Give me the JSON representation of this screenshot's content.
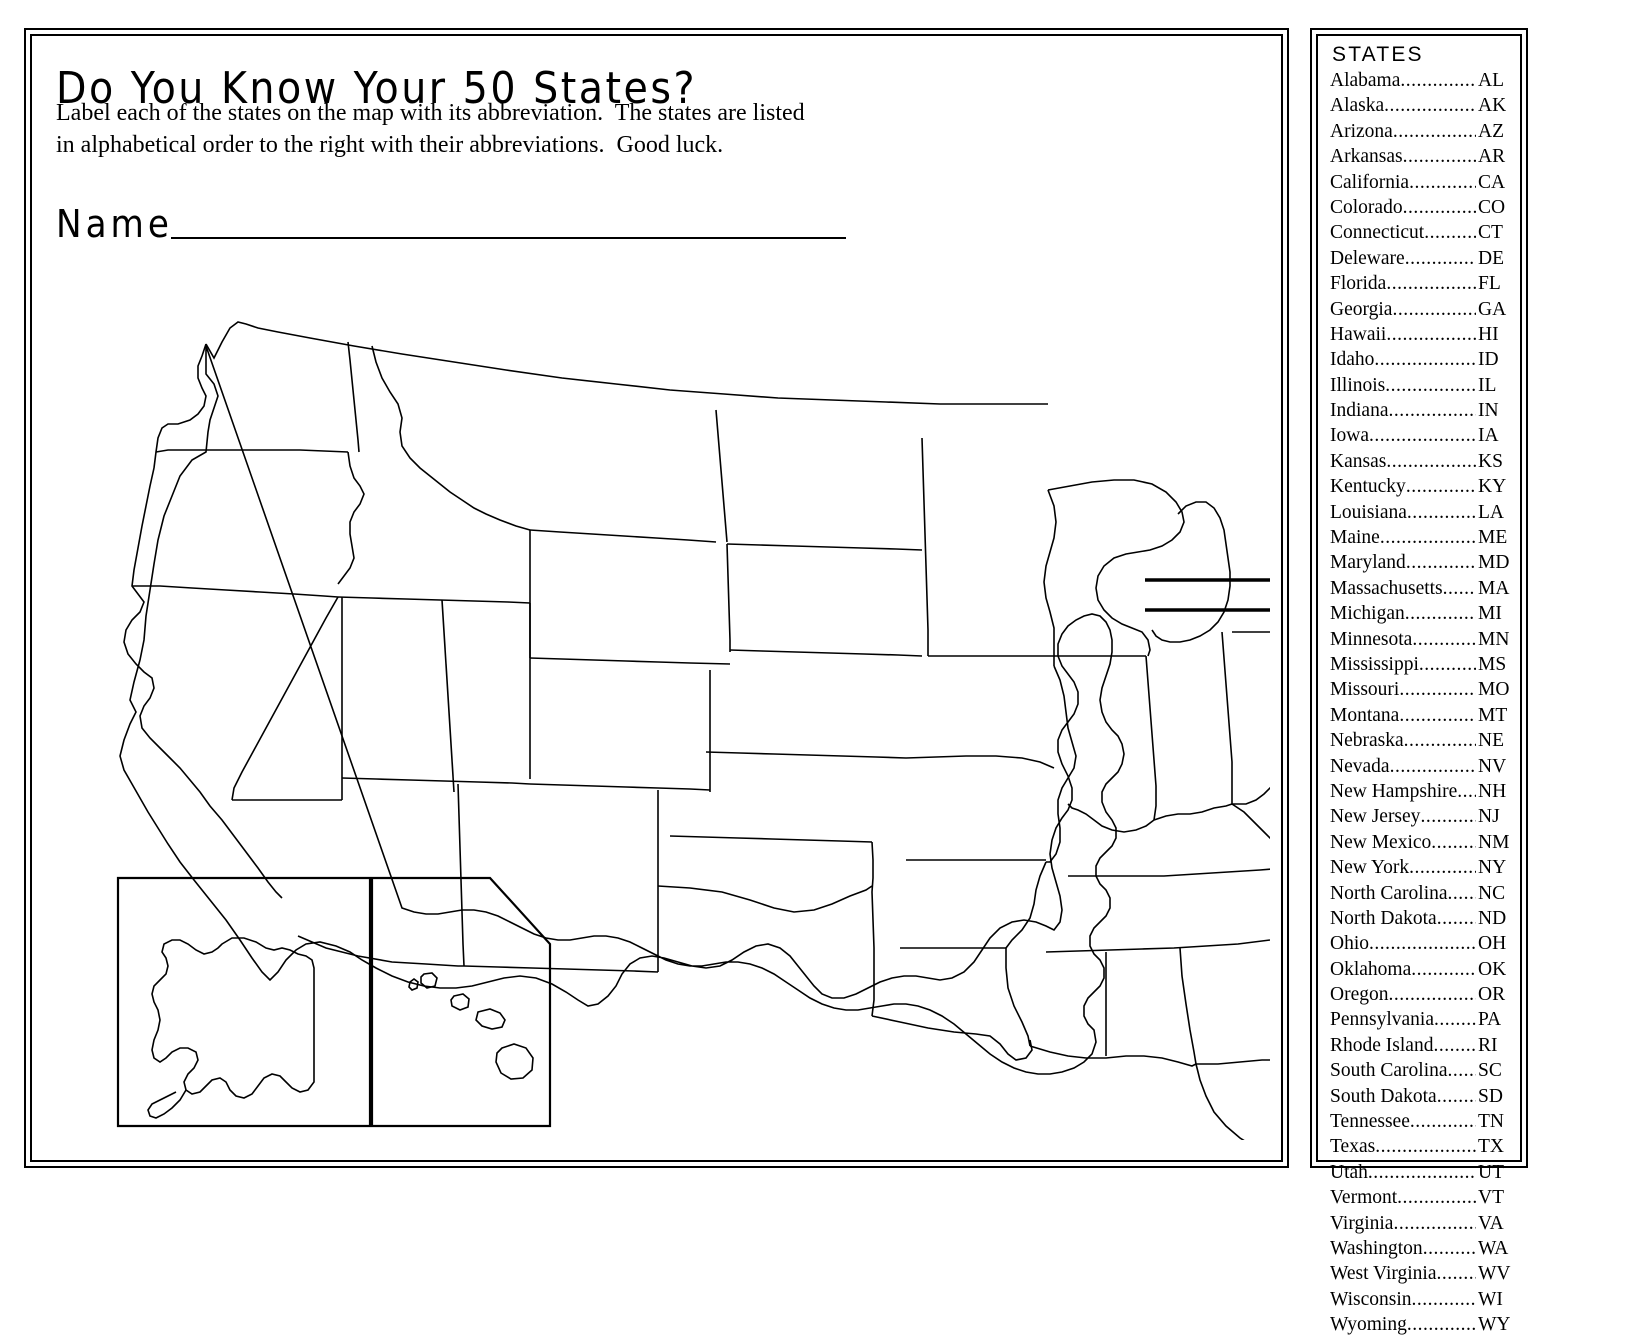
{
  "title": "Do You Know Your 50 States?",
  "instructions": {
    "line1": "Label each of the states on the map with its abbreviation.  The states are listed",
    "line2": "in alphabetical order to the right with their abbreviations.  Good luck."
  },
  "name_label": "Name",
  "states_panel": {
    "header": "STATES",
    "items": [
      {
        "name": "Alabama",
        "abbr": "AL"
      },
      {
        "name": "Alaska",
        "abbr": "AK"
      },
      {
        "name": "Arizona",
        "abbr": "AZ"
      },
      {
        "name": "Arkansas",
        "abbr": "AR"
      },
      {
        "name": "California",
        "abbr": "CA"
      },
      {
        "name": "Colorado",
        "abbr": "CO"
      },
      {
        "name": "Connecticut",
        "abbr": "CT"
      },
      {
        "name": "Deleware",
        "abbr": "DE"
      },
      {
        "name": "Florida",
        "abbr": "FL"
      },
      {
        "name": "Georgia",
        "abbr": "GA"
      },
      {
        "name": "Hawaii",
        "abbr": "HI"
      },
      {
        "name": "Idaho",
        "abbr": "ID"
      },
      {
        "name": "Illinois",
        "abbr": "IL"
      },
      {
        "name": "Indiana",
        "abbr": "IN"
      },
      {
        "name": "Iowa",
        "abbr": "IA"
      },
      {
        "name": "Kansas",
        "abbr": "KS"
      },
      {
        "name": "Kentucky",
        "abbr": "KY"
      },
      {
        "name": "Louisiana",
        "abbr": "LA"
      },
      {
        "name": "Maine",
        "abbr": "ME"
      },
      {
        "name": "Maryland",
        "abbr": "MD"
      },
      {
        "name": "Massachusetts",
        "abbr": "MA"
      },
      {
        "name": "Michigan",
        "abbr": "MI"
      },
      {
        "name": "Minnesota",
        "abbr": "MN"
      },
      {
        "name": "Mississippi",
        "abbr": "MS"
      },
      {
        "name": "Missouri",
        "abbr": "MO"
      },
      {
        "name": "Montana",
        "abbr": "MT"
      },
      {
        "name": "Nebraska",
        "abbr": "NE"
      },
      {
        "name": "Nevada",
        "abbr": "NV"
      },
      {
        "name": "New Hampshire",
        "abbr": "NH"
      },
      {
        "name": "New Jersey",
        "abbr": "NJ"
      },
      {
        "name": "New Mexico",
        "abbr": "NM"
      },
      {
        "name": "New York",
        "abbr": "NY"
      },
      {
        "name": "North Carolina",
        "abbr": "NC"
      },
      {
        "name": "North Dakota",
        "abbr": "ND"
      },
      {
        "name": "Ohio",
        "abbr": "OH"
      },
      {
        "name": "Oklahoma",
        "abbr": "OK"
      },
      {
        "name": "Oregon",
        "abbr": "OR"
      },
      {
        "name": "Pennsylvania",
        "abbr": "PA"
      },
      {
        "name": "Rhode Island",
        "abbr": "RI"
      },
      {
        "name": "South Carolina",
        "abbr": "SC"
      },
      {
        "name": "South Dakota",
        "abbr": "SD"
      },
      {
        "name": "Tennessee",
        "abbr": "TN"
      },
      {
        "name": "Texas",
        "abbr": "TX"
      },
      {
        "name": "Utah",
        "abbr": "UT"
      },
      {
        "name": "Vermont",
        "abbr": "VT"
      },
      {
        "name": "Virginia",
        "abbr": "VA"
      },
      {
        "name": "Washington",
        "abbr": "WA"
      },
      {
        "name": "West Virginia",
        "abbr": "WV"
      },
      {
        "name": "Wisconsin",
        "abbr": "WI"
      },
      {
        "name": "Wyoming",
        "abbr": "WY"
      }
    ]
  },
  "map": {
    "kind": "blank-outline-map-usa",
    "insets": [
      "alaska",
      "hawaii"
    ],
    "leader_line_count": 8,
    "colors": {
      "ink": "#000000",
      "paper": "#ffffff"
    }
  }
}
